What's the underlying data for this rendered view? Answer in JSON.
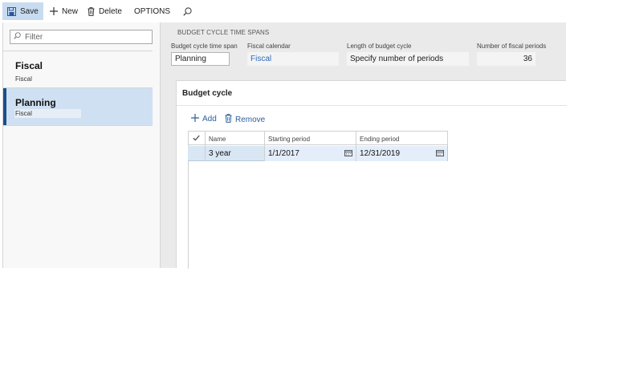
{
  "toolbar": {
    "save": "Save",
    "new": "New",
    "delete": "Delete",
    "options": "OPTIONS"
  },
  "left": {
    "filter_placeholder": "Filter",
    "items": [
      {
        "title": "Fiscal",
        "subtitle": "Fiscal"
      },
      {
        "title": "Planning",
        "subtitle": "Fiscal"
      }
    ]
  },
  "header": {
    "section_title": "BUDGET CYCLE TIME SPANS",
    "fields": {
      "time_span": {
        "label": "Budget cycle time span",
        "value": "Planning"
      },
      "calendar": {
        "label": "Fiscal calendar",
        "value": "Fiscal"
      },
      "length": {
        "label": "Length of budget cycle",
        "value": "Specify number of periods"
      },
      "periods": {
        "label": "Number of fiscal periods",
        "value": "36"
      }
    }
  },
  "budget_cycle": {
    "title": "Budget cycle",
    "add": "Add",
    "remove": "Remove",
    "columns": {
      "name": "Name",
      "start": "Starting period",
      "end": "Ending period"
    },
    "rows": [
      {
        "name": "3 year",
        "start": "1/1/2017",
        "end": "12/31/2019"
      }
    ]
  },
  "colors": {
    "accent": "#1a4f8a",
    "selected_bg": "#cfe0f2",
    "link": "#2c6bb5"
  },
  "icons": [
    "save-icon",
    "plus-icon",
    "trash-icon",
    "search-icon",
    "calendar-icon",
    "checkmark-icon"
  ]
}
